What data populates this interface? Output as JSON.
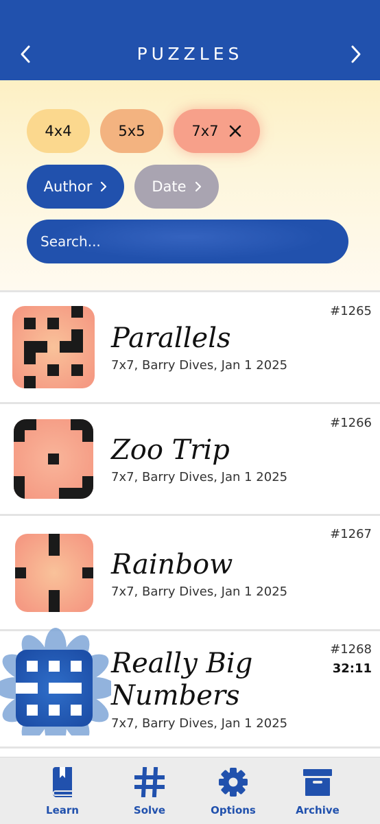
{
  "header": {
    "title": "PUZZLES"
  },
  "filters": {
    "size_chips": [
      {
        "label": "4x4",
        "color": "#fbd88e",
        "selected": false
      },
      {
        "label": "5x5",
        "color": "#f3b380",
        "selected": false
      },
      {
        "label": "7x7",
        "color": "#f7a08a",
        "selected": true
      }
    ],
    "author_label": "Author",
    "date_label": "Date",
    "search_placeholder": "Search..."
  },
  "puzzles": [
    {
      "number": "#1265",
      "name": "Parallels",
      "meta": "7x7, Barry Dives, Jan 1 2025"
    },
    {
      "number": "#1266",
      "name": "Zoo Trip",
      "meta": "7x7, Barry Dives, Jan 1 2025"
    },
    {
      "number": "#1267",
      "name": "Rainbow",
      "meta": "7x7, Barry Dives, Jan 1 2025"
    },
    {
      "number": "#1268",
      "name_line1": "Really Big",
      "name_line2": "Numbers",
      "meta": "7x7, Barry Dives, Jan 1 2025",
      "time": "32:11",
      "status": "solved"
    }
  ],
  "tabbar": {
    "items": [
      {
        "label": "Learn",
        "icon": "book-icon"
      },
      {
        "label": "Solve",
        "icon": "hash-icon"
      },
      {
        "label": "Options",
        "icon": "gear-icon"
      },
      {
        "label": "Archive",
        "icon": "archive-box-icon"
      }
    ]
  },
  "colors": {
    "brand": "#2151ad",
    "salmon": "#f7a08a",
    "gold": "#fbd88e",
    "peach": "#f3b380",
    "grey": "#a9a4b1"
  }
}
